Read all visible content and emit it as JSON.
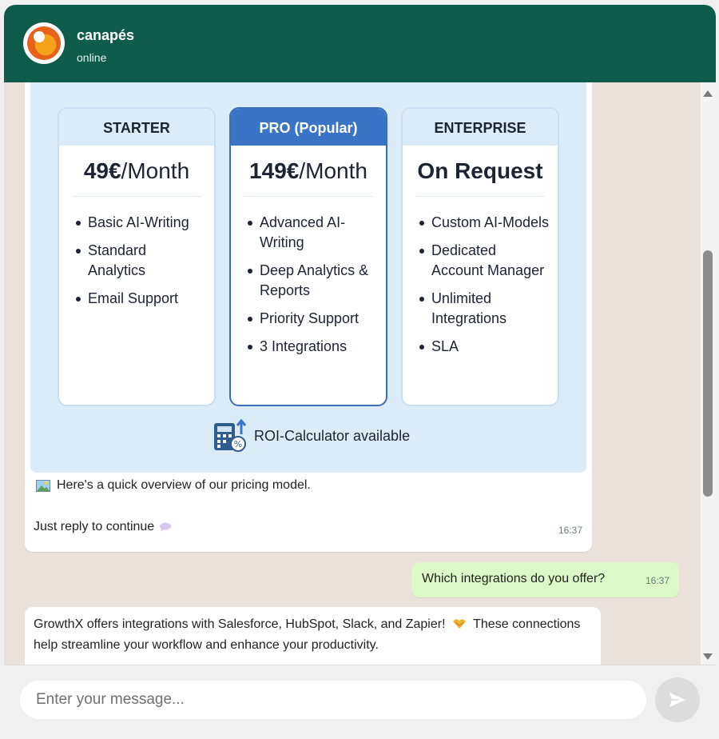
{
  "header": {
    "title": "canapés",
    "status": "online"
  },
  "pricing_card": {
    "plans": [
      {
        "name": "STARTER",
        "price_amount": "49€",
        "price_period": "/Month",
        "features": [
          "Basic AI-Writing",
          "Standard Analytics",
          "Email Support"
        ]
      },
      {
        "name": "PRO (Popular)",
        "price_amount": "149€",
        "price_period": "/Month",
        "features": [
          "Advanced AI-Writing",
          "Deep Analytics & Reports",
          "Priority Support",
          "3 Integrations"
        ]
      },
      {
        "name": "ENTERPRISE",
        "price_amount": "On Request",
        "price_period": "",
        "features": [
          "Custom AI-Models",
          "Dedicated Account Manager",
          "Unlimited Integrations",
          "SLA"
        ]
      }
    ],
    "roi_label": "ROI-Calculator available",
    "caption": "Here's a quick overview of our pricing model.",
    "reply_hint": "Just reply to continue",
    "time": "16:37"
  },
  "outgoing_message": {
    "text": "Which integrations do you offer?",
    "time": "16:37"
  },
  "answer_message": {
    "text_before": "GrowthX offers integrations with Salesforce, HubSpot, Slack, and Zapier!",
    "text_after": "These connections help streamline your workflow and enhance your productivity."
  },
  "composer": {
    "placeholder": "Enter your message..."
  },
  "colors": {
    "header_bg": "#0f5c4c",
    "chat_bg": "#e9e1da",
    "outgoing_bubble": "#dcf8c6",
    "pro_accent": "#3a74c7"
  },
  "icons": [
    "avatar-logo",
    "calculator-icon",
    "image-icon",
    "speech-bubble-icon",
    "handshake-icon",
    "send-icon"
  ]
}
